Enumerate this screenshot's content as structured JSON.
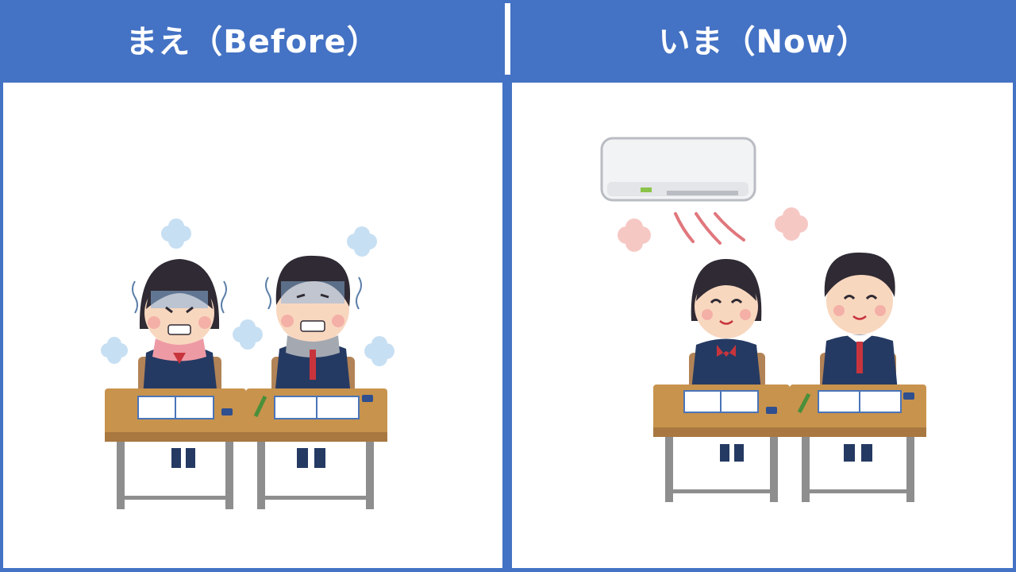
{
  "before": {
    "title": "まえ（Before）",
    "scene": "students-shivering-cold-classroom"
  },
  "now": {
    "title": "いま（Now）",
    "scene": "students-comfortable-with-air-conditioner"
  },
  "colors": {
    "frame_blue": "#4472c4",
    "panel_bg": "#ffffff",
    "desk_top": "#c8934d",
    "desk_leg": "#8e8e8e",
    "uniform_navy": "#253a63",
    "cold_cloud": "#c7dff3",
    "warm_cloud": "#f6c8c4"
  }
}
